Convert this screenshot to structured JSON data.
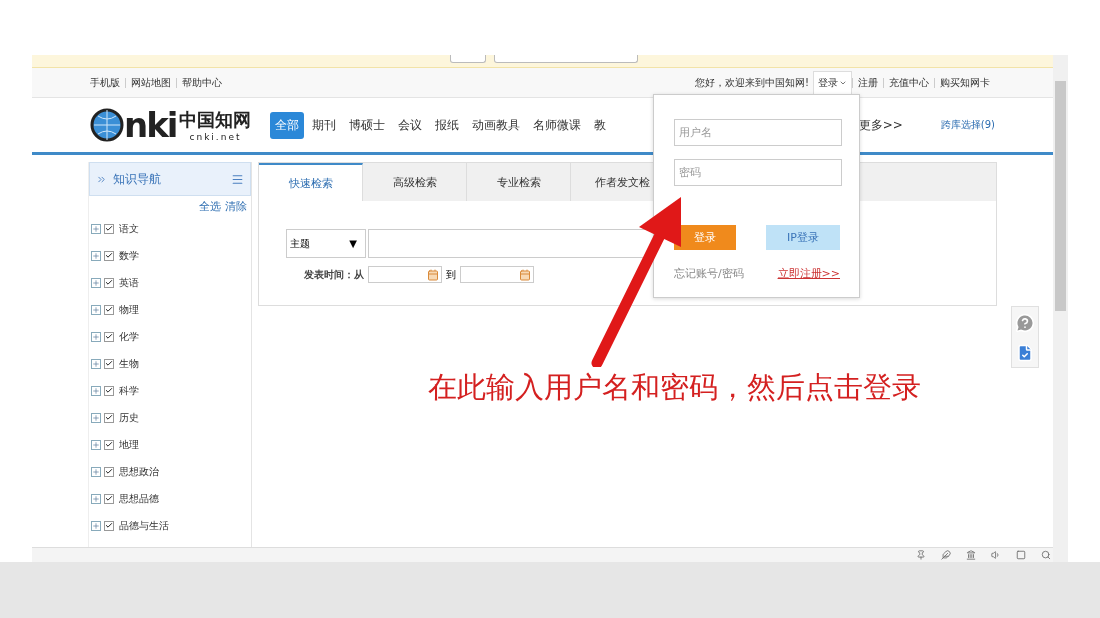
{
  "top_links": {
    "left": [
      "手机版",
      "网站地图",
      "帮助中心"
    ],
    "greeting": "您好，欢迎来到中国知网!",
    "login": "登录",
    "right": [
      "注册",
      "充值中心",
      "购买知网卡"
    ]
  },
  "logo": {
    "letters": "nki",
    "name": "中国知网",
    "domain": "cnki.net"
  },
  "nav": [
    {
      "label": "全部",
      "selected": true
    },
    {
      "label": "期刊",
      "selected": false
    },
    {
      "label": "博硕士",
      "selected": false
    },
    {
      "label": "会议",
      "selected": false
    },
    {
      "label": "报纸",
      "selected": false
    },
    {
      "label": "动画教具",
      "selected": false
    },
    {
      "label": "名师微课",
      "selected": false
    },
    {
      "label": "教",
      "selected": false
    }
  ],
  "nav_more": "更多>>",
  "cross_db": "跨库选择(9)",
  "sidebar": {
    "title": "知识导航",
    "select_all": "全选",
    "clear": "清除",
    "items": [
      {
        "label": "语文",
        "checked": true
      },
      {
        "label": "数学",
        "checked": true
      },
      {
        "label": "英语",
        "checked": true
      },
      {
        "label": "物理",
        "checked": true
      },
      {
        "label": "化学",
        "checked": true
      },
      {
        "label": "生物",
        "checked": true
      },
      {
        "label": "科学",
        "checked": true
      },
      {
        "label": "历史",
        "checked": true
      },
      {
        "label": "地理",
        "checked": true
      },
      {
        "label": "思想政治",
        "checked": true
      },
      {
        "label": "思想品德",
        "checked": true
      },
      {
        "label": "品德与生活",
        "checked": true
      }
    ]
  },
  "search_tabs": [
    {
      "label": "快速检索",
      "selected": true
    },
    {
      "label": "高级检索",
      "selected": false
    },
    {
      "label": "专业检索",
      "selected": false
    },
    {
      "label": "作者发文检",
      "selected": false
    }
  ],
  "search": {
    "field": "主题",
    "caret": "▼",
    "date_label": "发表时间：从",
    "date_to": "到"
  },
  "login_popup": {
    "username_placeholder": "用户名",
    "password_placeholder": "密码",
    "login_button": "登录",
    "ip_login_button": "IP登录",
    "forgot": "忘记账号/密码",
    "register": "立即注册>>"
  },
  "annotation": "在此输入用户名和密码，然后点击登录"
}
